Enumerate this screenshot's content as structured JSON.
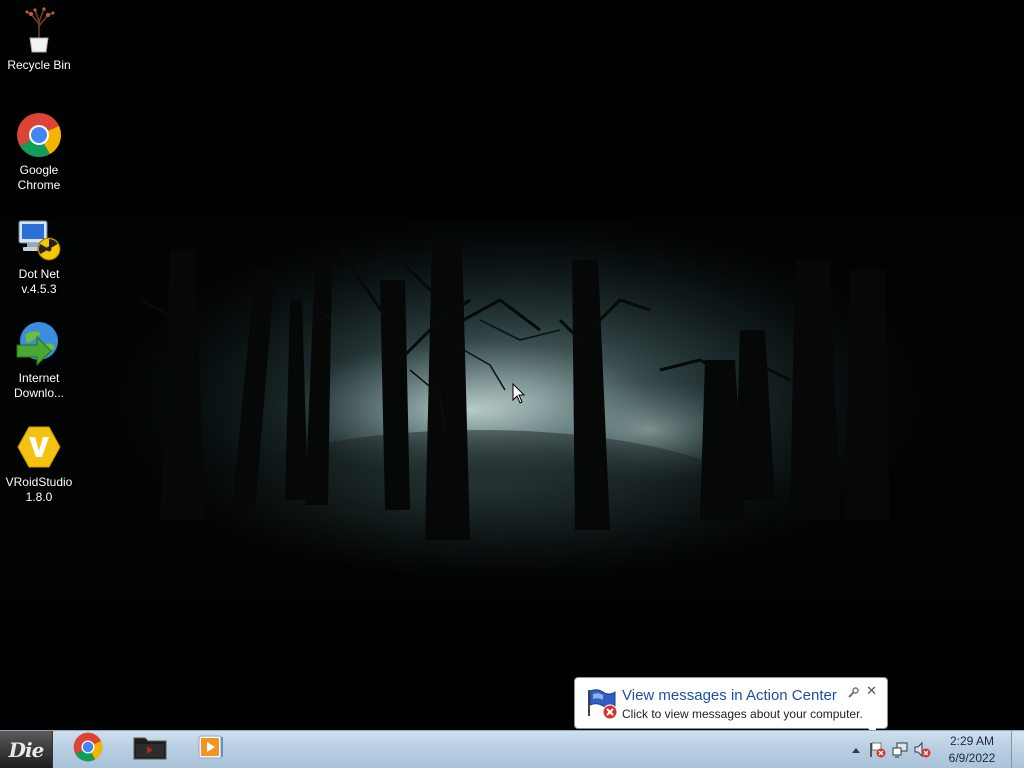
{
  "desktop": {
    "icons": [
      {
        "label": "Recycle Bin",
        "icon": "recycle-bin-icon"
      },
      {
        "label": "Google\nChrome",
        "icon": "chrome-icon"
      },
      {
        "label": "Dot Net\nv.4.5.3",
        "icon": "dotnet-installer-icon"
      },
      {
        "label": "Internet\nDownlo...",
        "icon": "internet-download-manager-icon"
      },
      {
        "label": "VRoidStudio\n1.8.0",
        "icon": "vroid-studio-icon"
      }
    ]
  },
  "taskbar": {
    "start_label": "Die",
    "pinned": [
      {
        "name": "Google Chrome",
        "icon": "chrome-icon"
      },
      {
        "name": "File Explorer",
        "icon": "folder-icon"
      },
      {
        "name": "Media Player",
        "icon": "media-player-icon"
      }
    ],
    "tray": {
      "show_hidden_icon": "up-arrow-icon",
      "icons": [
        "action-center-flag-icon",
        "network-icon",
        "volume-muted-icon"
      ],
      "time": "2:29 AM",
      "date": "6/9/2022"
    }
  },
  "notification": {
    "title": "View messages in Action Center",
    "text": "Click to view messages about your computer.",
    "icon": "action-center-flag-icon",
    "title_color": "#1f4fa8"
  },
  "colors": {
    "taskbar": "#b9cfe2",
    "desktop_text": "#ffffff"
  }
}
